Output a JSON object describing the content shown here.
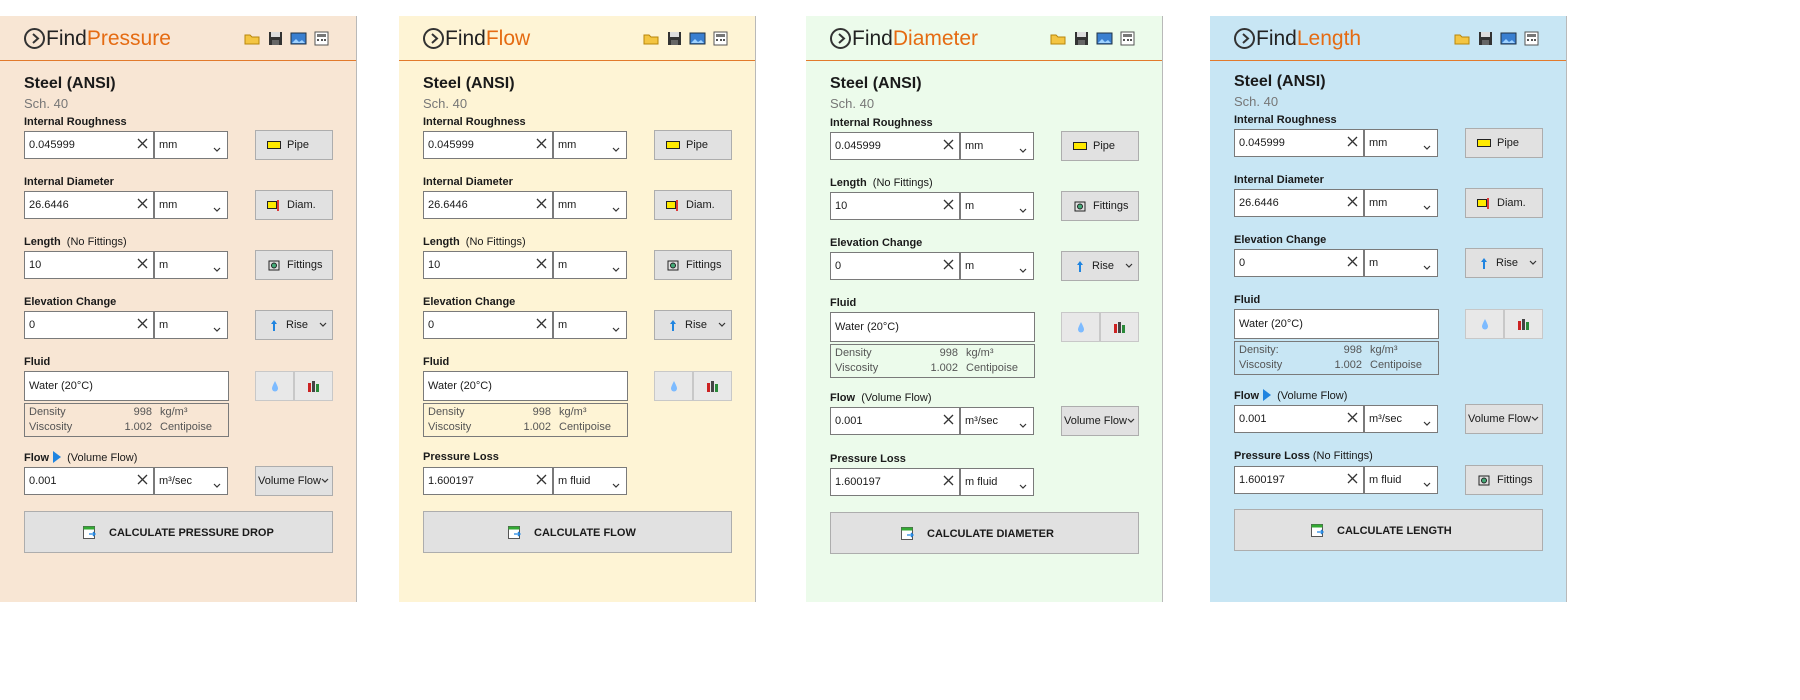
{
  "colors": {
    "pressure_bg": "#f8e6d4",
    "flow_bg": "#fef4d5",
    "diameter_bg": "#ecfbeb",
    "length_bg": "#c8e6f4",
    "accent": "#e56b12"
  },
  "icons": [
    "open-folder-icon",
    "save-icon",
    "image-icon",
    "calculator-icon",
    "clear-icon",
    "chevron-down-icon",
    "pipe-icon",
    "diameter-icon",
    "fittings-icon",
    "rise-icon",
    "water-drop-icon",
    "fluid-chart-icon",
    "flow-arrow-icon",
    "calculate-icon"
  ],
  "panels": {
    "pressure": {
      "title_a": "Find",
      "title_b": "Pressure",
      "material": "Steel (ANSI)",
      "schedule": "Sch.  40",
      "roughness_label": "Internal Roughness",
      "roughness_value": "0.045999",
      "roughness_unit": "mm",
      "pipe_button": "Pipe",
      "diameter_label": "Internal Diameter",
      "diameter_value": "26.6446",
      "diameter_unit": "mm",
      "diam_button": "Diam.",
      "length_label": "Length",
      "length_note": "(No Fittings)",
      "length_value": "10",
      "length_unit": "m",
      "fittings_button": "Fittings",
      "elev_label": "Elevation Change",
      "elev_value": "0",
      "elev_unit": "m",
      "rise_button": "Rise",
      "fluid_label": "Fluid",
      "fluid_value": "Water (20°C)",
      "density_label": "Density",
      "density_value": "998",
      "density_unit": "kg/m³",
      "viscosity_label": "Viscosity",
      "viscosity_value": "1.002",
      "viscosity_unit": "Centipoise",
      "flow_label": "Flow",
      "flow_note": "(Volume Flow)",
      "flow_value": "0.001",
      "flow_unit": "m³/sec",
      "flow_button": "Volume Flow",
      "calc_button": "CALCULATE PRESSURE DROP"
    },
    "flow": {
      "title_a": "Find",
      "title_b": "Flow",
      "material": "Steel (ANSI)",
      "schedule": "Sch.  40",
      "roughness_label": "Internal Roughness",
      "roughness_value": "0.045999",
      "roughness_unit": "mm",
      "pipe_button": "Pipe",
      "diameter_label": "Internal Diameter",
      "diameter_value": "26.6446",
      "diameter_unit": "mm",
      "diam_button": "Diam.",
      "length_label": "Length",
      "length_note": "(No Fittings)",
      "length_value": "10",
      "length_unit": "m",
      "fittings_button": "Fittings",
      "elev_label": "Elevation Change",
      "elev_value": "0",
      "elev_unit": "m",
      "rise_button": "Rise",
      "fluid_label": "Fluid",
      "fluid_value": "Water (20°C)",
      "density_label": "Density",
      "density_value": "998",
      "density_unit": "kg/m³",
      "viscosity_label": "Viscosity",
      "viscosity_value": "1.002",
      "viscosity_unit": "Centipoise",
      "loss_label": "Pressure Loss",
      "loss_value": "1.600197",
      "loss_unit": "m fluid",
      "calc_button": "CALCULATE FLOW"
    },
    "diameter": {
      "title_a": "Find",
      "title_b": "Diameter",
      "material": "Steel (ANSI)",
      "schedule": "Sch.  40",
      "roughness_label": "Internal Roughness",
      "roughness_value": "0.045999",
      "roughness_unit": "mm",
      "pipe_button": "Pipe",
      "length_label": "Length",
      "length_note": "(No Fittings)",
      "length_value": "10",
      "length_unit": "m",
      "fittings_button": "Fittings",
      "elev_label": "Elevation Change",
      "elev_value": "0",
      "elev_unit": "m",
      "rise_button": "Rise",
      "fluid_label": "Fluid",
      "fluid_value": "Water (20°C)",
      "density_label": "Density",
      "density_value": "998",
      "density_unit": "kg/m³",
      "viscosity_label": "Viscosity",
      "viscosity_value": "1.002",
      "viscosity_unit": "Centipoise",
      "flow_label": "Flow",
      "flow_note": "(Volume Flow)",
      "flow_value": "0.001",
      "flow_unit": "m³/sec",
      "flow_button": "Volume Flow",
      "loss_label": "Pressure Loss",
      "loss_value": "1.600197",
      "loss_unit": "m fluid",
      "calc_button": "CALCULATE DIAMETER"
    },
    "length": {
      "title_a": "Find",
      "title_b": "Length",
      "material": "Steel (ANSI)",
      "schedule": "Sch.  40",
      "roughness_label": "Internal Roughness",
      "roughness_value": "0.045999",
      "roughness_unit": "mm",
      "pipe_button": "Pipe",
      "diameter_label": "Internal Diameter",
      "diameter_value": "26.6446",
      "diameter_unit": "mm",
      "diam_button": "Diam.",
      "elev_label": "Elevation Change",
      "elev_value": "0",
      "elev_unit": "m",
      "rise_button": "Rise",
      "fluid_label": "Fluid",
      "fluid_value": "Water (20°C)",
      "density_label": "Density:",
      "density_value": "998",
      "density_unit": "kg/m³",
      "viscosity_label": "Viscosity",
      "viscosity_value": "1.002",
      "viscosity_unit": "Centipoise",
      "flow_label": "Flow",
      "flow_note": "(Volume Flow)",
      "flow_value": "0.001",
      "flow_unit": "m³/sec",
      "flow_button": "Volume Flow",
      "loss_label": "Pressure Loss",
      "loss_note": "(No Fittings)",
      "loss_value": "1.600197",
      "loss_unit": "m fluid",
      "fittings_button": "Fittings",
      "calc_button": "CALCULATE LENGTH"
    }
  }
}
